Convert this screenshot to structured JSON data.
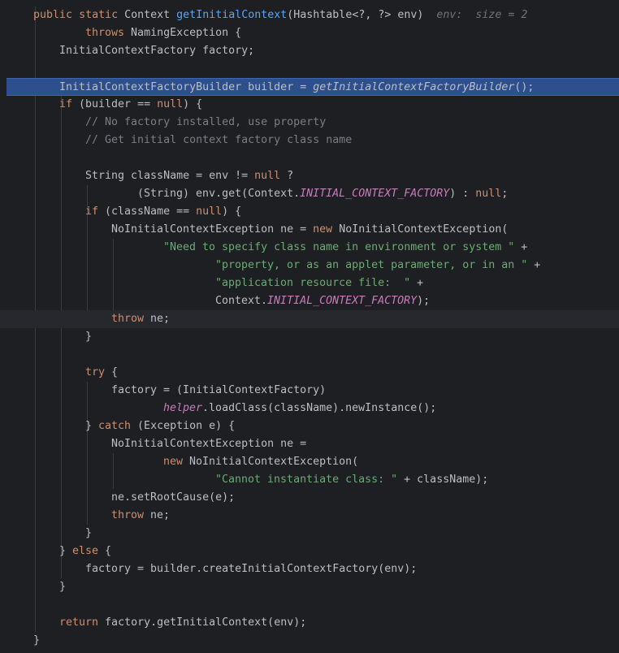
{
  "editor": {
    "language": "java",
    "colors": {
      "background": "#1e1f22",
      "execution_line": "#2d4f8e",
      "keyword": "#cf8e6d",
      "function": "#56a8f5",
      "static_field": "#c77dbb",
      "string": "#6aab73",
      "comment": "#7a7e85",
      "text": "#bcbec4"
    },
    "execution_point_line": 5,
    "caret_line": 18,
    "lines": [
      {
        "n": 1,
        "indent": 4,
        "tokens": [
          [
            "kw",
            "public"
          ],
          [
            "p",
            " "
          ],
          [
            "kw",
            "static"
          ],
          [
            "p",
            " Context "
          ],
          [
            "fn",
            "getInitialContext"
          ],
          [
            "p",
            "(Hashtable<?, ?> env)  "
          ],
          [
            "hint",
            "env:  size = 2"
          ]
        ]
      },
      {
        "n": 2,
        "indent": 12,
        "tokens": [
          [
            "kw",
            "throws"
          ],
          [
            "p",
            " NamingException {"
          ]
        ]
      },
      {
        "n": 3,
        "indent": 8,
        "tokens": [
          [
            "p",
            "InitialContextFactory factory;"
          ]
        ]
      },
      {
        "n": 4,
        "indent": 0,
        "tokens": []
      },
      {
        "n": 5,
        "indent": 8,
        "tokens": [
          [
            "p",
            "InitialContextFactoryBuilder builder = "
          ],
          [
            "call",
            "getInitialContextFactoryBuilder"
          ],
          [
            "p",
            "();"
          ]
        ]
      },
      {
        "n": 6,
        "indent": 8,
        "tokens": [
          [
            "kw",
            "if"
          ],
          [
            "p",
            " (builder == "
          ],
          [
            "kw",
            "null"
          ],
          [
            "p",
            ") {"
          ]
        ]
      },
      {
        "n": 7,
        "indent": 12,
        "tokens": [
          [
            "com",
            "// No factory installed, use property"
          ]
        ]
      },
      {
        "n": 8,
        "indent": 12,
        "tokens": [
          [
            "com",
            "// Get initial context factory class name"
          ]
        ]
      },
      {
        "n": 9,
        "indent": 0,
        "tokens": []
      },
      {
        "n": 10,
        "indent": 12,
        "tokens": [
          [
            "p",
            "String className = env != "
          ],
          [
            "kw",
            "null"
          ],
          [
            "p",
            " ?"
          ]
        ]
      },
      {
        "n": 11,
        "indent": 20,
        "tokens": [
          [
            "p",
            "(String) env.get(Context."
          ],
          [
            "sf",
            "INITIAL_CONTEXT_FACTORY"
          ],
          [
            "p",
            ") : "
          ],
          [
            "kw",
            "null"
          ],
          [
            "p",
            ";"
          ]
        ]
      },
      {
        "n": 12,
        "indent": 12,
        "tokens": [
          [
            "kw",
            "if"
          ],
          [
            "p",
            " (className == "
          ],
          [
            "kw",
            "null"
          ],
          [
            "p",
            ") {"
          ]
        ]
      },
      {
        "n": 13,
        "indent": 16,
        "tokens": [
          [
            "p",
            "NoInitialContextException ne = "
          ],
          [
            "kw",
            "new"
          ],
          [
            "p",
            " NoInitialContextException("
          ]
        ]
      },
      {
        "n": 14,
        "indent": 24,
        "tokens": [
          [
            "str",
            "\"Need to specify class name in environment or system \""
          ],
          [
            "p",
            " +"
          ]
        ]
      },
      {
        "n": 15,
        "indent": 32,
        "tokens": [
          [
            "str",
            "\"property, or as an applet parameter, or in an \""
          ],
          [
            "p",
            " +"
          ]
        ]
      },
      {
        "n": 16,
        "indent": 32,
        "tokens": [
          [
            "str",
            "\"application resource file:  \""
          ],
          [
            "p",
            " +"
          ]
        ]
      },
      {
        "n": 17,
        "indent": 32,
        "tokens": [
          [
            "p",
            "Context."
          ],
          [
            "sf",
            "INITIAL_CONTEXT_FACTORY"
          ],
          [
            "p",
            ");"
          ]
        ]
      },
      {
        "n": 18,
        "indent": 16,
        "tokens": [
          [
            "kw",
            "throw"
          ],
          [
            "p",
            " ne;"
          ]
        ]
      },
      {
        "n": 19,
        "indent": 12,
        "tokens": [
          [
            "p",
            "}"
          ]
        ]
      },
      {
        "n": 20,
        "indent": 0,
        "tokens": []
      },
      {
        "n": 21,
        "indent": 12,
        "tokens": [
          [
            "kw",
            "try"
          ],
          [
            "p",
            " {"
          ]
        ]
      },
      {
        "n": 22,
        "indent": 16,
        "tokens": [
          [
            "p",
            "factory = (InitialContextFactory)"
          ]
        ]
      },
      {
        "n": 23,
        "indent": 24,
        "tokens": [
          [
            "sf",
            "helper"
          ],
          [
            "p",
            ".loadClass(className).newInstance();"
          ]
        ]
      },
      {
        "n": 24,
        "indent": 12,
        "tokens": [
          [
            "p",
            "} "
          ],
          [
            "kw",
            "catch"
          ],
          [
            "p",
            " (Exception e) {"
          ]
        ]
      },
      {
        "n": 25,
        "indent": 16,
        "tokens": [
          [
            "p",
            "NoInitialContextException ne ="
          ]
        ]
      },
      {
        "n": 26,
        "indent": 24,
        "tokens": [
          [
            "kw",
            "new"
          ],
          [
            "p",
            " NoInitialContextException("
          ]
        ]
      },
      {
        "n": 27,
        "indent": 32,
        "tokens": [
          [
            "str",
            "\"Cannot instantiate class: \""
          ],
          [
            "p",
            " + className);"
          ]
        ]
      },
      {
        "n": 28,
        "indent": 16,
        "tokens": [
          [
            "p",
            "ne.setRootCause(e);"
          ]
        ]
      },
      {
        "n": 29,
        "indent": 16,
        "tokens": [
          [
            "kw",
            "throw"
          ],
          [
            "p",
            " ne;"
          ]
        ]
      },
      {
        "n": 30,
        "indent": 12,
        "tokens": [
          [
            "p",
            "}"
          ]
        ]
      },
      {
        "n": 31,
        "indent": 8,
        "tokens": [
          [
            "p",
            "} "
          ],
          [
            "kw",
            "else"
          ],
          [
            "p",
            " {"
          ]
        ]
      },
      {
        "n": 32,
        "indent": 12,
        "tokens": [
          [
            "p",
            "factory = builder.createInitialContextFactory(env);"
          ]
        ]
      },
      {
        "n": 33,
        "indent": 8,
        "tokens": [
          [
            "p",
            "}"
          ]
        ]
      },
      {
        "n": 34,
        "indent": 0,
        "tokens": []
      },
      {
        "n": 35,
        "indent": 8,
        "tokens": [
          [
            "kw",
            "return"
          ],
          [
            "p",
            " factory.getInitialContext(env);"
          ]
        ]
      },
      {
        "n": 36,
        "indent": 4,
        "tokens": [
          [
            "p",
            "}"
          ]
        ]
      }
    ]
  }
}
